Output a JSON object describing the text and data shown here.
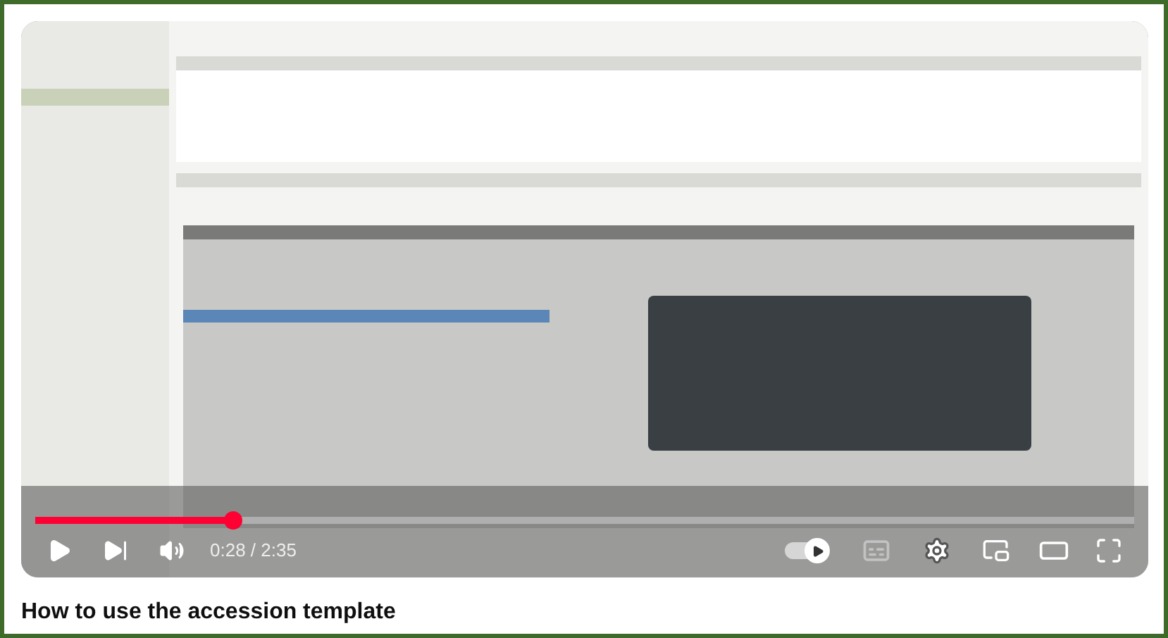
{
  "video": {
    "kind": "picture",
    "progress": {
      "level": 0.18
    },
    "time": "0:28 / 2:35",
    "autoplay": {
      "on": true
    },
    "captions": {
      "disabled": true
    }
  },
  "title": "How to use the accession template"
}
